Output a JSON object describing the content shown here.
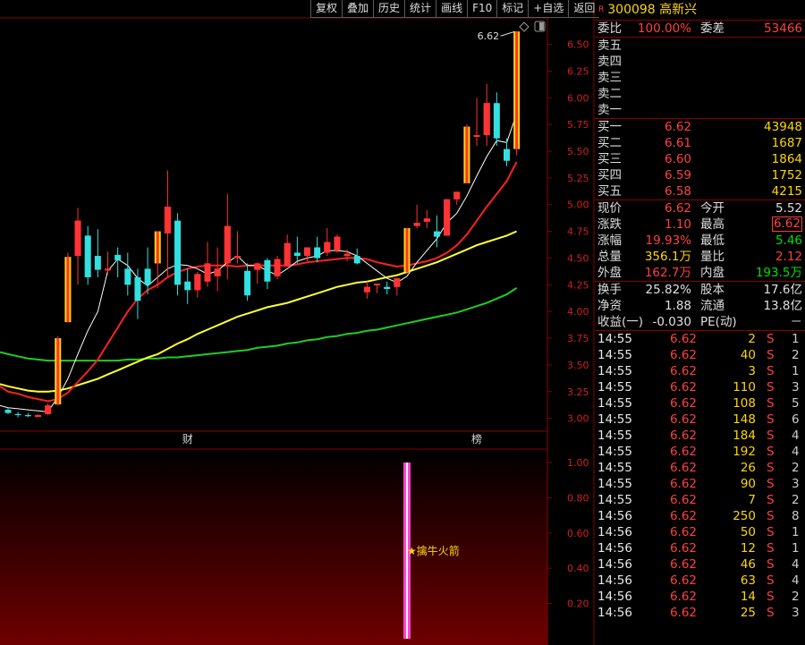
{
  "toolbar": [
    "复权",
    "叠加",
    "历史",
    "统计",
    "画线",
    "F10",
    "标记",
    "+自选",
    "返回"
  ],
  "stock": {
    "badge": "R",
    "code_name": "300098 高新兴"
  },
  "quote": {
    "weibi": {
      "label": "委比",
      "value": "100.00%",
      "label2": "委差",
      "value2": "53466"
    },
    "sell": [
      {
        "label": "卖五",
        "price": "",
        "vol": ""
      },
      {
        "label": "卖四",
        "price": "",
        "vol": ""
      },
      {
        "label": "卖三",
        "price": "",
        "vol": ""
      },
      {
        "label": "卖二",
        "price": "",
        "vol": ""
      },
      {
        "label": "卖一",
        "price": "",
        "vol": ""
      }
    ],
    "buy": [
      {
        "label": "买一",
        "price": "6.62",
        "vol": "43948"
      },
      {
        "label": "买二",
        "price": "6.61",
        "vol": "1687"
      },
      {
        "label": "买三",
        "price": "6.60",
        "vol": "1864"
      },
      {
        "label": "买四",
        "price": "6.59",
        "vol": "1752"
      },
      {
        "label": "买五",
        "price": "6.58",
        "vol": "4215"
      }
    ],
    "stats1": [
      {
        "l1": "现价",
        "v1": "6.62",
        "c1": "red",
        "l2": "今开",
        "v2": "5.52",
        "c2": "wht",
        "box": false
      },
      {
        "l1": "涨跌",
        "v1": "1.10",
        "c1": "red",
        "l2": "最高",
        "v2": "6.62",
        "c2": "red",
        "box": true
      },
      {
        "l1": "涨幅",
        "v1": "19.93%",
        "c1": "red",
        "l2": "最低",
        "v2": "5.46",
        "c2": "grn",
        "box": false
      },
      {
        "l1": "总量",
        "v1": "356.1万",
        "c1": "yel",
        "l2": "量比",
        "v2": "2.12",
        "c2": "red",
        "box": false
      },
      {
        "l1": "外盘",
        "v1": "162.7万",
        "c1": "red",
        "l2": "内盘",
        "v2": "193.5万",
        "c2": "grn",
        "box": false
      }
    ],
    "stats2": [
      {
        "l1": "换手",
        "v1": "25.82%",
        "c1": "wht",
        "l2": "股本",
        "v2": "17.6亿",
        "c2": "wht"
      },
      {
        "l1": "净资",
        "v1": "1.88",
        "c1": "wht",
        "l2": "流通",
        "v2": "13.8亿",
        "c2": "wht"
      },
      {
        "l1": "收益(一)",
        "v1": "-0.030",
        "c1": "wht",
        "l2": "PE(动)",
        "v2": "－",
        "c2": "wht"
      }
    ],
    "ticks": [
      {
        "t": "14:55",
        "p": "6.62",
        "q": "2",
        "s": "S",
        "n": "1"
      },
      {
        "t": "14:55",
        "p": "6.62",
        "q": "40",
        "s": "S",
        "n": "2"
      },
      {
        "t": "14:55",
        "p": "6.62",
        "q": "3",
        "s": "S",
        "n": "1"
      },
      {
        "t": "14:55",
        "p": "6.62",
        "q": "110",
        "s": "S",
        "n": "3"
      },
      {
        "t": "14:55",
        "p": "6.62",
        "q": "108",
        "s": "S",
        "n": "5"
      },
      {
        "t": "14:55",
        "p": "6.62",
        "q": "148",
        "s": "S",
        "n": "6"
      },
      {
        "t": "14:55",
        "p": "6.62",
        "q": "184",
        "s": "S",
        "n": "4"
      },
      {
        "t": "14:55",
        "p": "6.62",
        "q": "192",
        "s": "S",
        "n": "4"
      },
      {
        "t": "14:55",
        "p": "6.62",
        "q": "26",
        "s": "S",
        "n": "2"
      },
      {
        "t": "14:55",
        "p": "6.62",
        "q": "90",
        "s": "S",
        "n": "3"
      },
      {
        "t": "14:55",
        "p": "6.62",
        "q": "7",
        "s": "S",
        "n": "2"
      },
      {
        "t": "14:56",
        "p": "6.62",
        "q": "250",
        "s": "S",
        "n": "8"
      },
      {
        "t": "14:56",
        "p": "6.62",
        "q": "50",
        "s": "S",
        "n": "1"
      },
      {
        "t": "14:56",
        "p": "6.62",
        "q": "12",
        "s": "S",
        "n": "1"
      },
      {
        "t": "14:56",
        "p": "6.62",
        "q": "46",
        "s": "S",
        "n": "4"
      },
      {
        "t": "14:56",
        "p": "6.62",
        "q": "63",
        "s": "S",
        "n": "4"
      },
      {
        "t": "14:56",
        "p": "6.62",
        "q": "14",
        "s": "S",
        "n": "2"
      },
      {
        "t": "14:56",
        "p": "6.62",
        "q": "25",
        "s": "S",
        "n": "3"
      }
    ]
  },
  "colors": {
    "up": "#ff3333",
    "down": "#33e0e0",
    "limit_up": "#ffd700",
    "ma5": "#ffffff",
    "ma10": "#ff2020",
    "ma20": "#ffff33",
    "ma60": "#22cc22",
    "signal": "#ff44cc",
    "grid": "#8a0000"
  },
  "chart_data": [
    {
      "type": "candlestick",
      "ylim": [
        2.85,
        6.7
      ],
      "yticks": [
        "6.50",
        "6.25",
        "6.00",
        "5.75",
        "5.50",
        "5.25",
        "5.00",
        "4.75",
        "4.50",
        "4.25",
        "4.00",
        "3.75",
        "3.50",
        "3.25",
        "3.00"
      ],
      "max_label": "6.62",
      "bottom_markers": [
        {
          "index": 18,
          "text": "财"
        },
        {
          "index": 47,
          "text": "榜"
        }
      ],
      "ohlc": [
        [
          3.08,
          3.1,
          3.04,
          3.05
        ],
        [
          3.04,
          3.06,
          3.01,
          3.03
        ],
        [
          3.03,
          3.05,
          3.01,
          3.02
        ],
        [
          3.02,
          3.04,
          3.01,
          3.03
        ],
        [
          3.04,
          3.14,
          3.03,
          3.12
        ],
        [
          3.13,
          3.77,
          3.12,
          3.75
        ],
        [
          3.9,
          4.55,
          3.9,
          4.51
        ],
        [
          4.52,
          4.97,
          4.25,
          4.85
        ],
        [
          4.71,
          4.8,
          4.25,
          4.32
        ],
        [
          4.52,
          4.77,
          4.32,
          4.39
        ],
        [
          4.39,
          4.56,
          4.35,
          4.4
        ],
        [
          4.53,
          4.6,
          4.32,
          4.48
        ],
        [
          4.4,
          4.55,
          4.15,
          4.25
        ],
        [
          4.32,
          4.4,
          3.93,
          4.1
        ],
        [
          4.4,
          4.6,
          4.16,
          4.25
        ],
        [
          4.45,
          4.6,
          4.22,
          4.75
        ],
        [
          4.73,
          5.32,
          4.32,
          4.98
        ],
        [
          4.85,
          4.92,
          4.15,
          4.25
        ],
        [
          4.28,
          4.4,
          4.07,
          4.2
        ],
        [
          4.2,
          4.37,
          4.13,
          4.35
        ],
        [
          4.28,
          4.65,
          4.23,
          4.45
        ],
        [
          4.33,
          4.6,
          4.19,
          4.4
        ],
        [
          4.45,
          5.1,
          4.3,
          4.8
        ],
        [
          4.5,
          4.75,
          4.45,
          4.52
        ],
        [
          4.38,
          4.45,
          4.1,
          4.15
        ],
        [
          4.39,
          4.46,
          4.26,
          4.45
        ],
        [
          4.48,
          4.5,
          4.21,
          4.28
        ],
        [
          4.33,
          4.52,
          4.3,
          4.49
        ],
        [
          4.42,
          4.72,
          4.42,
          4.64
        ],
        [
          4.55,
          4.7,
          4.45,
          4.52
        ],
        [
          4.52,
          4.6,
          4.47,
          4.6
        ],
        [
          4.6,
          4.7,
          4.46,
          4.5
        ],
        [
          4.55,
          4.78,
          4.52,
          4.65
        ],
        [
          4.57,
          4.72,
          4.55,
          4.7
        ],
        [
          4.52,
          4.58,
          4.47,
          4.54
        ],
        [
          4.52,
          4.59,
          4.44,
          4.45
        ],
        [
          4.18,
          4.28,
          4.12,
          4.23
        ],
        [
          4.26,
          4.26,
          4.17,
          4.26
        ],
        [
          4.23,
          4.28,
          4.16,
          4.21
        ],
        [
          4.23,
          4.28,
          4.15,
          4.31
        ],
        [
          4.37,
          4.78,
          4.35,
          4.78
        ],
        [
          4.8,
          5.0,
          4.78,
          4.83
        ],
        [
          4.84,
          4.95,
          4.78,
          4.87
        ],
        [
          4.75,
          4.9,
          4.6,
          4.7
        ],
        [
          4.71,
          5.05,
          4.71,
          5.05
        ],
        [
          5.05,
          5.12,
          5.0,
          5.12
        ],
        [
          5.2,
          5.75,
          5.2,
          5.73
        ],
        [
          5.65,
          6.0,
          5.55,
          5.65
        ],
        [
          5.65,
          6.13,
          5.55,
          5.95
        ],
        [
          5.95,
          6.05,
          5.55,
          5.62
        ],
        [
          5.52,
          5.62,
          5.36,
          5.41
        ],
        [
          5.52,
          6.62,
          5.46,
          6.62
        ]
      ],
      "ma5": [
        3.1,
        3.09,
        3.08,
        3.07,
        3.06,
        3.2,
        3.37,
        3.6,
        3.82,
        4.0,
        4.38,
        4.49,
        4.43,
        4.31,
        4.24,
        4.32,
        4.4,
        4.44,
        4.43,
        4.4,
        4.35,
        4.38,
        4.46,
        4.52,
        4.43,
        4.43,
        4.38,
        4.34,
        4.4,
        4.47,
        4.5,
        4.52,
        4.57,
        4.57,
        4.56,
        4.52,
        4.45,
        4.38,
        4.31,
        4.27,
        4.33,
        4.46,
        4.57,
        4.68,
        4.83,
        4.92,
        5.08,
        5.27,
        5.45,
        5.6,
        5.58,
        5.85
      ],
      "ma10": [
        3.25,
        3.23,
        3.2,
        3.18,
        3.16,
        3.18,
        3.24,
        3.34,
        3.44,
        3.55,
        3.7,
        3.85,
        4.0,
        4.12,
        4.2,
        4.25,
        4.32,
        4.37,
        4.4,
        4.42,
        4.43,
        4.43,
        4.43,
        4.42,
        4.43,
        4.43,
        4.43,
        4.43,
        4.43,
        4.44,
        4.46,
        4.47,
        4.48,
        4.49,
        4.5,
        4.5,
        4.49,
        4.46,
        4.44,
        4.42,
        4.43,
        4.45,
        4.47,
        4.5,
        4.55,
        4.62,
        4.72,
        4.85,
        4.98,
        5.1,
        5.22,
        5.4
      ],
      "ma20": [
        3.3,
        3.28,
        3.26,
        3.25,
        3.25,
        3.26,
        3.28,
        3.31,
        3.34,
        3.37,
        3.41,
        3.45,
        3.49,
        3.53,
        3.57,
        3.6,
        3.65,
        3.7,
        3.74,
        3.79,
        3.83,
        3.87,
        3.91,
        3.95,
        3.98,
        4.01,
        4.04,
        4.06,
        4.08,
        4.11,
        4.14,
        4.17,
        4.2,
        4.23,
        4.25,
        4.27,
        4.28,
        4.3,
        4.32,
        4.34,
        4.37,
        4.4,
        4.43,
        4.46,
        4.5,
        4.54,
        4.58,
        4.62,
        4.65,
        4.68,
        4.71,
        4.75
      ],
      "ma60": [
        3.6,
        3.58,
        3.56,
        3.55,
        3.54,
        3.54,
        3.54,
        3.54,
        3.54,
        3.54,
        3.54,
        3.54,
        3.55,
        3.55,
        3.56,
        3.56,
        3.57,
        3.57,
        3.58,
        3.59,
        3.6,
        3.61,
        3.62,
        3.63,
        3.64,
        3.66,
        3.67,
        3.68,
        3.7,
        3.71,
        3.73,
        3.74,
        3.76,
        3.77,
        3.79,
        3.8,
        3.82,
        3.83,
        3.85,
        3.87,
        3.89,
        3.91,
        3.93,
        3.95,
        3.97,
        3.99,
        4.02,
        4.05,
        4.08,
        4.12,
        4.16,
        4.22
      ]
    },
    {
      "type": "bar",
      "ylim": [
        0,
        1.05
      ],
      "yticks": [
        "1.00",
        "0.80",
        "0.60",
        "0.40",
        "0.20"
      ],
      "signal_index": 40,
      "signal_value": 1.0,
      "signal_label": "★擒牛火箭"
    }
  ]
}
